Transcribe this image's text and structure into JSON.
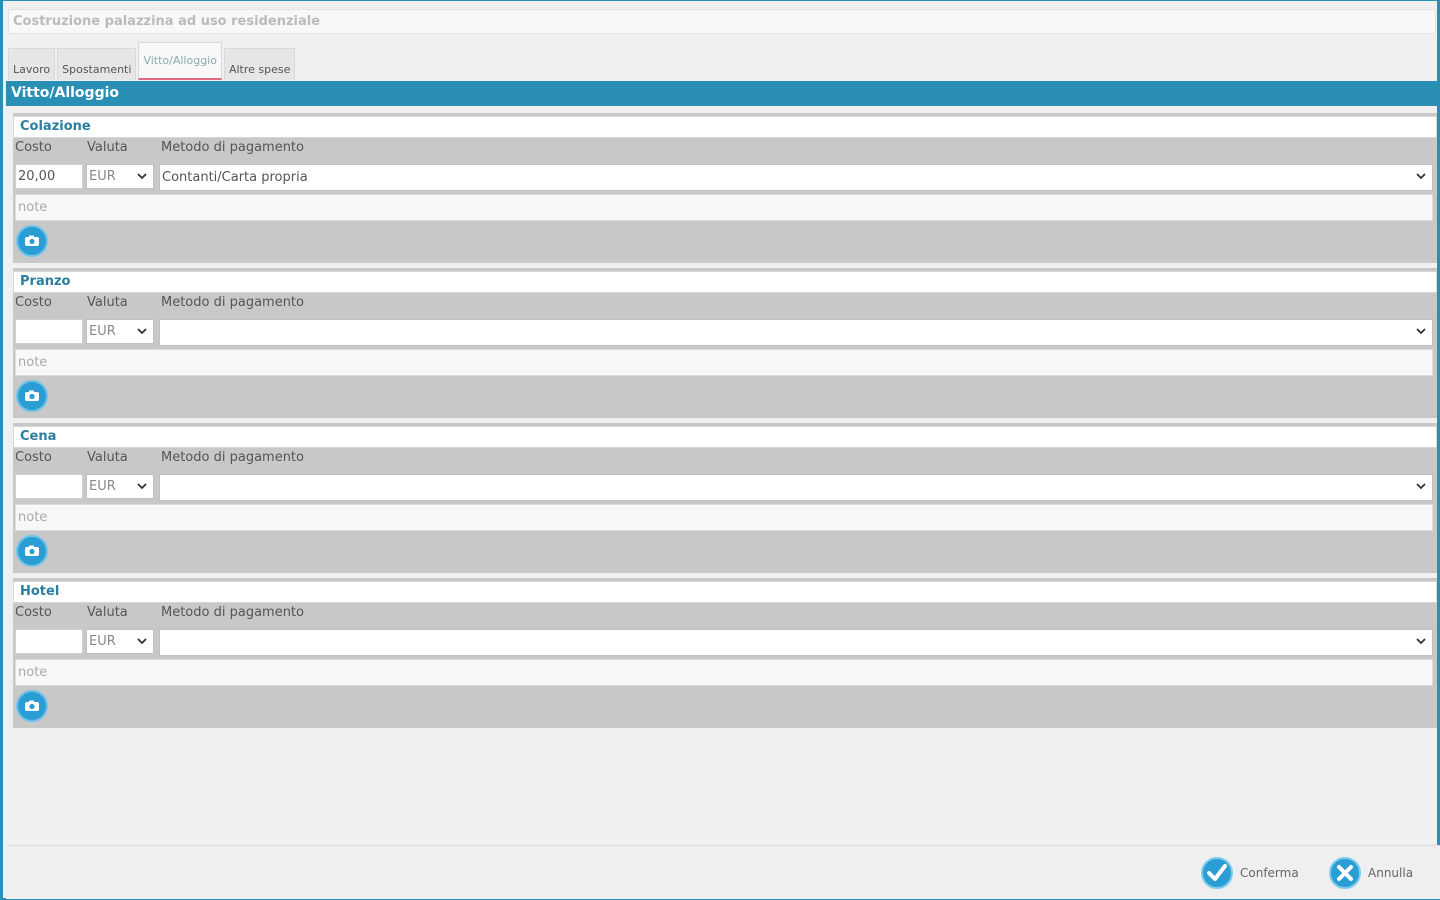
{
  "project_title": "Costruzione palazzina ad uso residenziale",
  "tabs": [
    {
      "label": "Lavoro",
      "active": false
    },
    {
      "label": "Spostamenti",
      "active": false
    },
    {
      "label": "Vitto/Alloggio",
      "active": true
    },
    {
      "label": "Altre spese",
      "active": false
    }
  ],
  "section_title": "Vitto/Alloggio",
  "labels": {
    "costo": "Costo",
    "valuta": "Valuta",
    "metodo": "Metodo di pagamento",
    "note_placeholder": "note"
  },
  "groups": [
    {
      "title": "Colazione",
      "costo": "20,00",
      "valuta": "EUR",
      "metodo": "Contanti/Carta propria",
      "note": ""
    },
    {
      "title": "Pranzo",
      "costo": "",
      "valuta": "EUR",
      "metodo": "",
      "note": ""
    },
    {
      "title": "Cena",
      "costo": "",
      "valuta": "EUR",
      "metodo": "",
      "note": ""
    },
    {
      "title": "Hotel",
      "costo": "",
      "valuta": "EUR",
      "metodo": "",
      "note": ""
    }
  ],
  "footer": {
    "confirm_label": "Conferma",
    "cancel_label": "Annulla"
  },
  "colors": {
    "accent": "#2a8fb4",
    "tab_indicator": "#e06b80",
    "group_bg": "#c8c8c8"
  },
  "icons": {
    "attach": "camera-icon",
    "confirm": "check-circle-icon",
    "cancel": "x-circle-icon"
  }
}
